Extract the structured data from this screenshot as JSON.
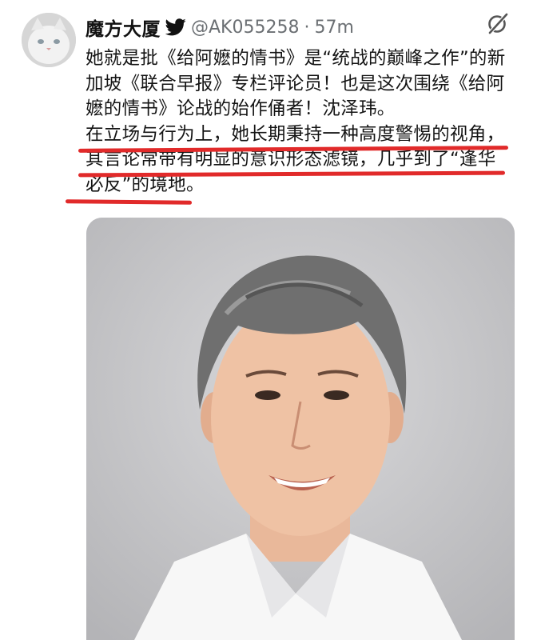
{
  "tweet": {
    "display_name": "魔方大厦",
    "handle": "@AK055258",
    "separator": "·",
    "time": "57m",
    "body_lines": [
      "她就是批《给阿嬷的情书》是“统战的巅峰之作”的新",
      "加坡《联合早报》专栏评论员！也是这次围绕《给阿",
      "嬷的情书》论战的始作俑者！沈泽玮。",
      "在立场与行为上，她长期秉持一种高度警惕的视角，",
      "其言论常带有明显的意识形态滤镜，几乎到了“逢华",
      "必反”的境地。"
    ]
  },
  "icons": {
    "verified": "twitter-bird-icon",
    "grok": "grok-icon"
  },
  "colors": {
    "underline": "#e12a2a",
    "handle_gray": "#6b6f73",
    "photo_bg": "#c7c7c9"
  }
}
